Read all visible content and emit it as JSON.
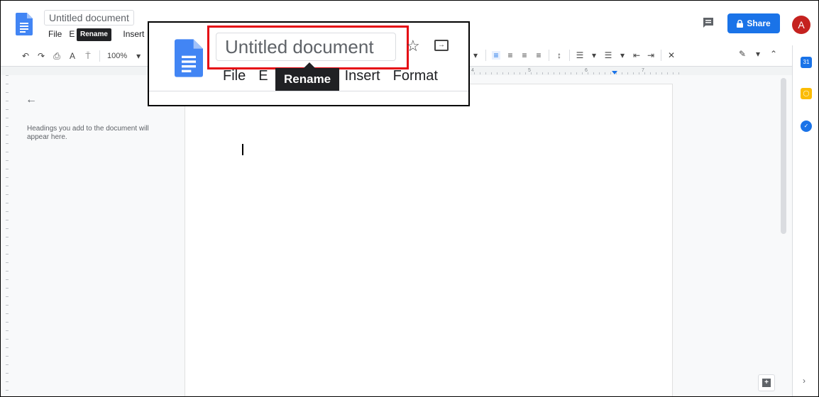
{
  "header": {
    "doc_title": "Untitled document",
    "menu": [
      "File",
      "E",
      "Insert"
    ],
    "tooltip": "Rename",
    "share_label": "Share",
    "avatar_letter": "A"
  },
  "toolbar": {
    "zoom": "100%"
  },
  "ruler": {
    "labels": [
      "4",
      "5",
      "6",
      "7"
    ]
  },
  "outline": {
    "hint": "Headings you add to the document will appear here."
  },
  "callout": {
    "doc_title": "Untitled document",
    "menu": [
      "File",
      "E",
      "Insert",
      "Format"
    ],
    "tooltip": "Rename"
  },
  "colors": {
    "accent": "#1a73e8",
    "highlight": "#e50914"
  }
}
